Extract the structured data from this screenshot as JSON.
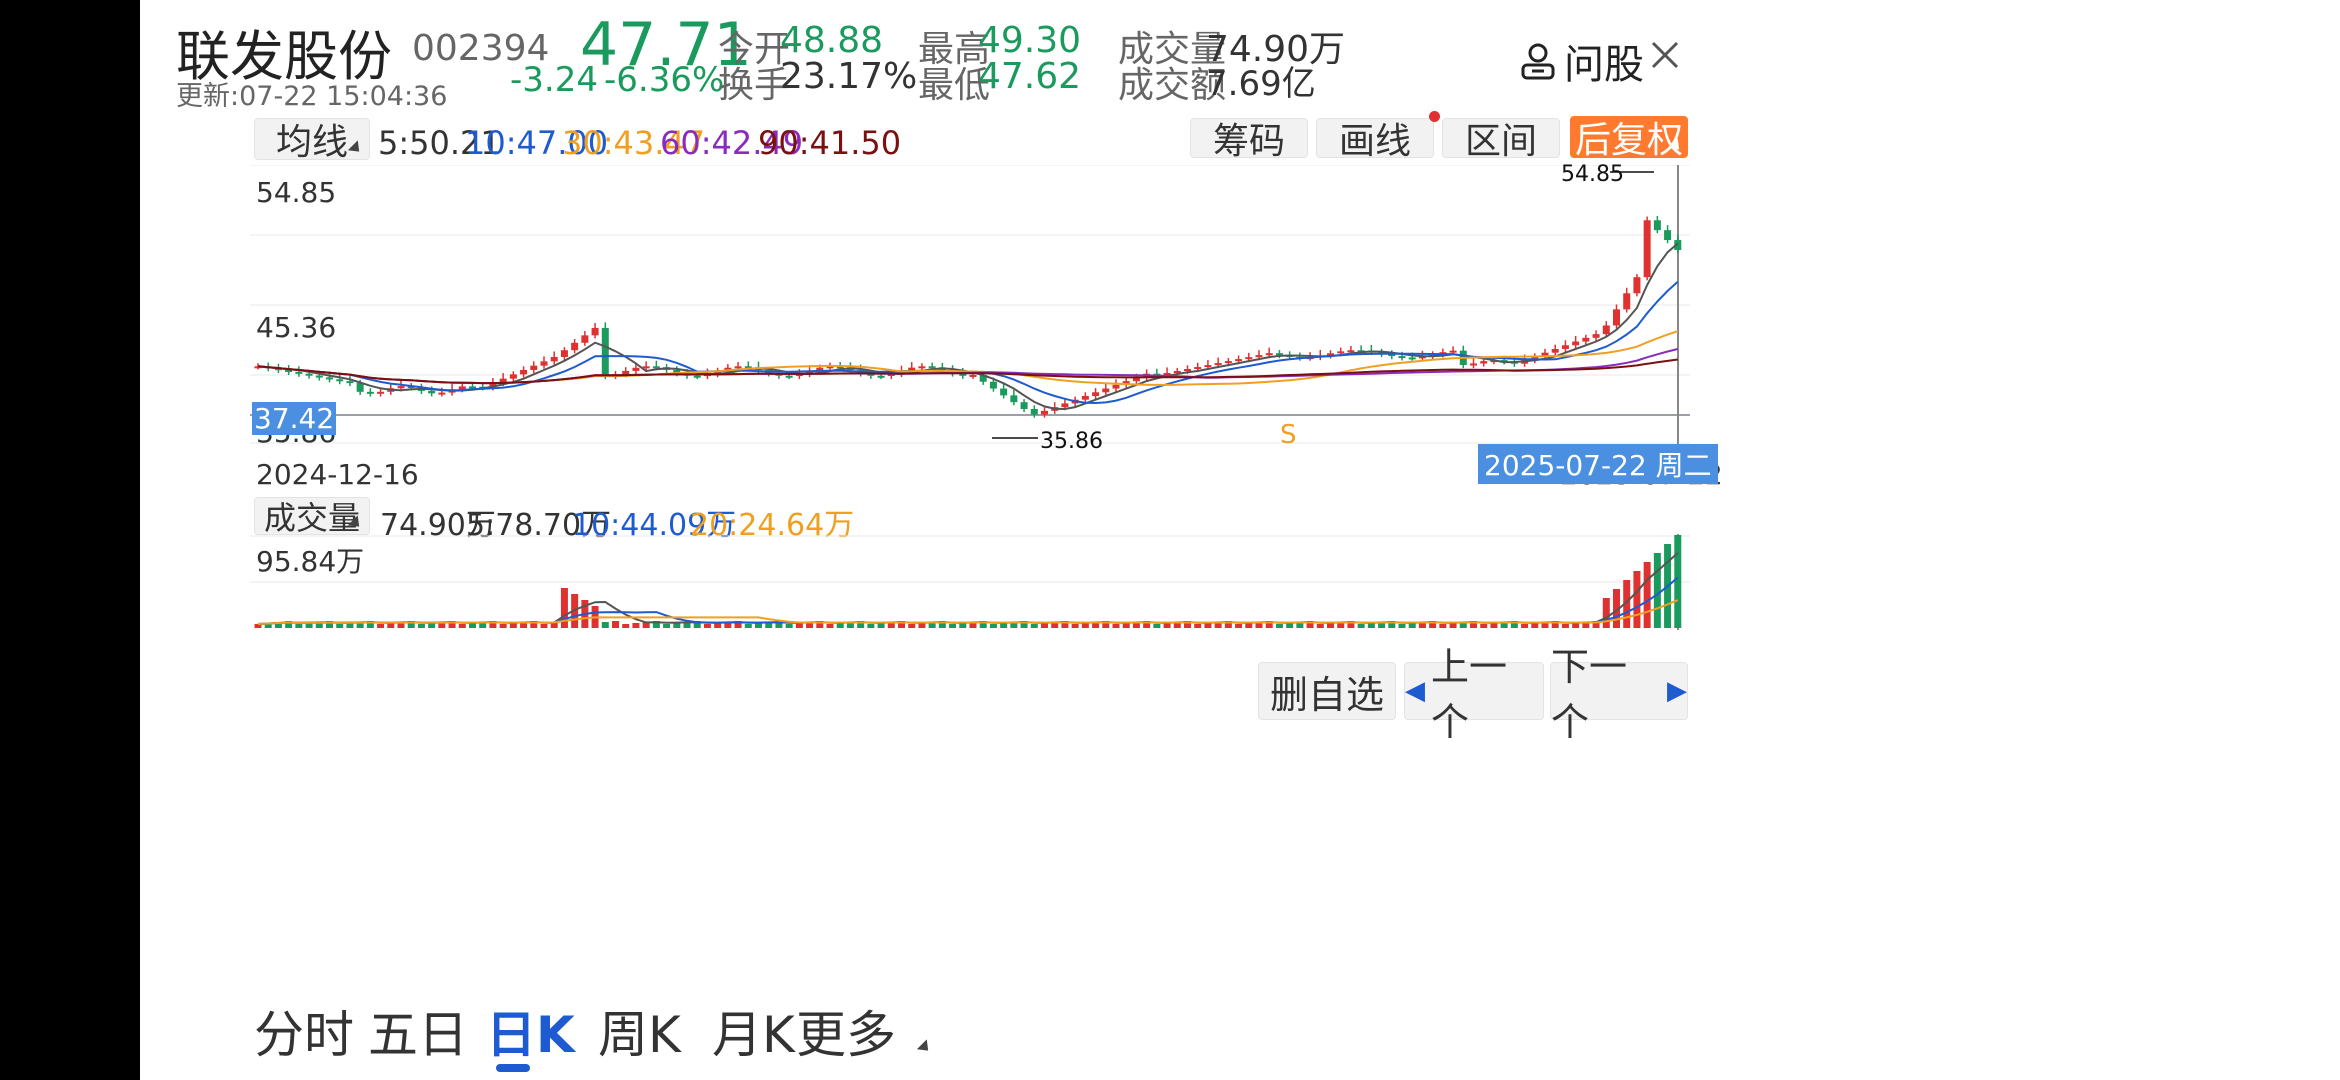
{
  "stock": {
    "name": "联发股份",
    "code": "002394",
    "updated": "更新:07-22 15:04:36",
    "price": "47.71",
    "change": "-3.24",
    "change_pct": "-6.36%"
  },
  "quote": {
    "open_label": "今开",
    "open": "48.88",
    "turnover_label": "换手",
    "turnover": "23.17%",
    "high_label": "最高",
    "high": "49.30",
    "low_label": "最低",
    "low": "47.62",
    "volume_label": "成交量",
    "volume": "74.90万",
    "amount_label": "成交额",
    "amount": "7.69亿"
  },
  "header_actions": {
    "ask_label": "问股"
  },
  "toolbar": {
    "ma_selector": "均线",
    "ma5": "5:50.21",
    "ma10": "10:47.00",
    "ma30": "30:43.47",
    "ma60": "60:42.49",
    "ma90": "90:41.50",
    "chips": "筹码",
    "draw": "画线",
    "range": "区间",
    "adjust": "后复权"
  },
  "price_chart": {
    "y_top": "54.85",
    "y_mid": "45.36",
    "y_bottom": "35.86",
    "current_label": "37.42",
    "max_marker": "54.85",
    "min_marker": "35.86",
    "signal": "S",
    "start_date": "2024-12-16",
    "end_date": "2025-07-22",
    "crosshair_date": "2025-07-22 周二"
  },
  "volume_toolbar": {
    "selector": "成交量",
    "vol": "74.90万",
    "ma5": "5:78.70万",
    "ma10": "10:44.09万",
    "ma20": "20:24.64万",
    "y_top": "95.84万"
  },
  "tabs": {
    "intraday": "分时",
    "five_day": "五日",
    "daily": "日K",
    "weekly": "周K",
    "monthly": "月K",
    "more": "更多"
  },
  "bottom_buttons": {
    "remove_watch": "删自选",
    "prev": "上一个",
    "next": "下一个"
  },
  "colors": {
    "up": "#e03131",
    "down": "#1a9a5c",
    "accent": "#ff7a2e",
    "ma5": "#555555",
    "ma10": "#1e5bd1",
    "ma30": "#f0a020",
    "ma60": "#8a2bbf",
    "ma90": "#7a1010"
  }
}
